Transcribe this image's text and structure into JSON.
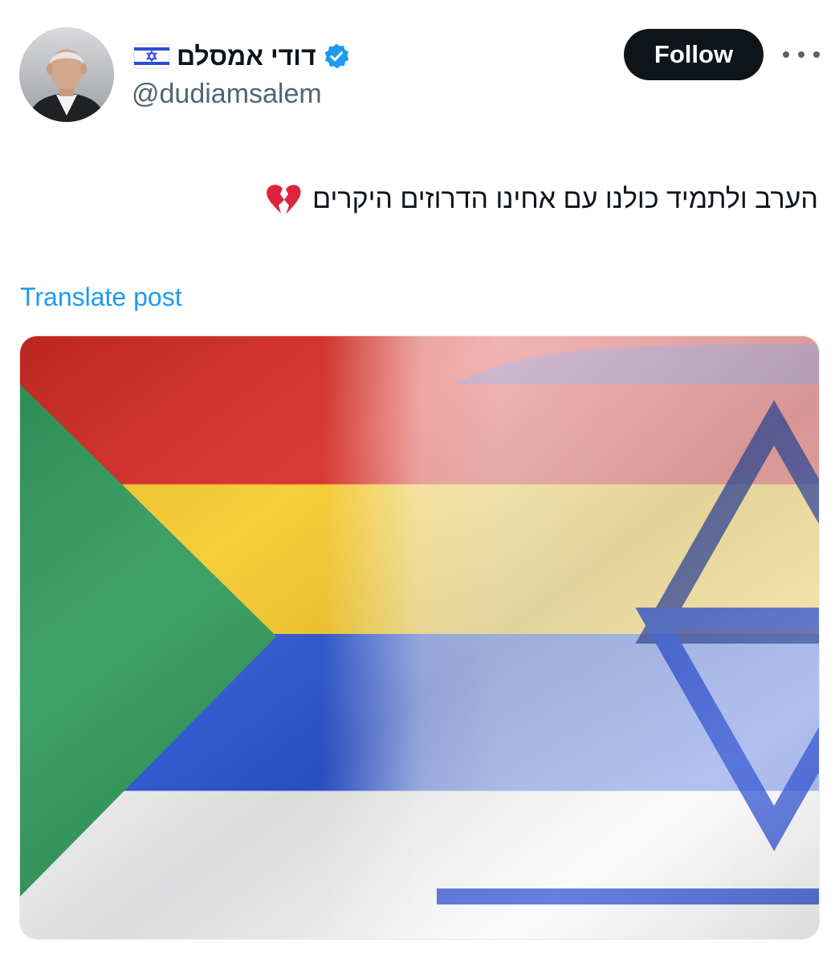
{
  "author": {
    "display_name": "דודי אמסלם",
    "handle": "@dudiamsalem",
    "verified": true,
    "flag_icon": "israel-flag-icon",
    "avatar_icon": "profile-photo"
  },
  "actions": {
    "follow_label": "Follow",
    "more_icon": "more-horizontal-icon"
  },
  "post": {
    "text": "הערב ולתמיד כולנו עם אחינו הדרוזים היקרים",
    "emoji_icon": "broken-heart-icon",
    "translate_label": "Translate post",
    "image_icon": "druze-israel-flag-blend"
  },
  "colors": {
    "follow_bg": "#0f1419",
    "link": "#1d9bf0",
    "verified": "#1d9bf0",
    "handle": "#536471",
    "druze_red": "#d62a23",
    "druze_yellow": "#f5c92a",
    "druze_blue": "#2e57d6",
    "druze_green": "#2f9a5a",
    "israel_blue": "#2a4fd3"
  }
}
